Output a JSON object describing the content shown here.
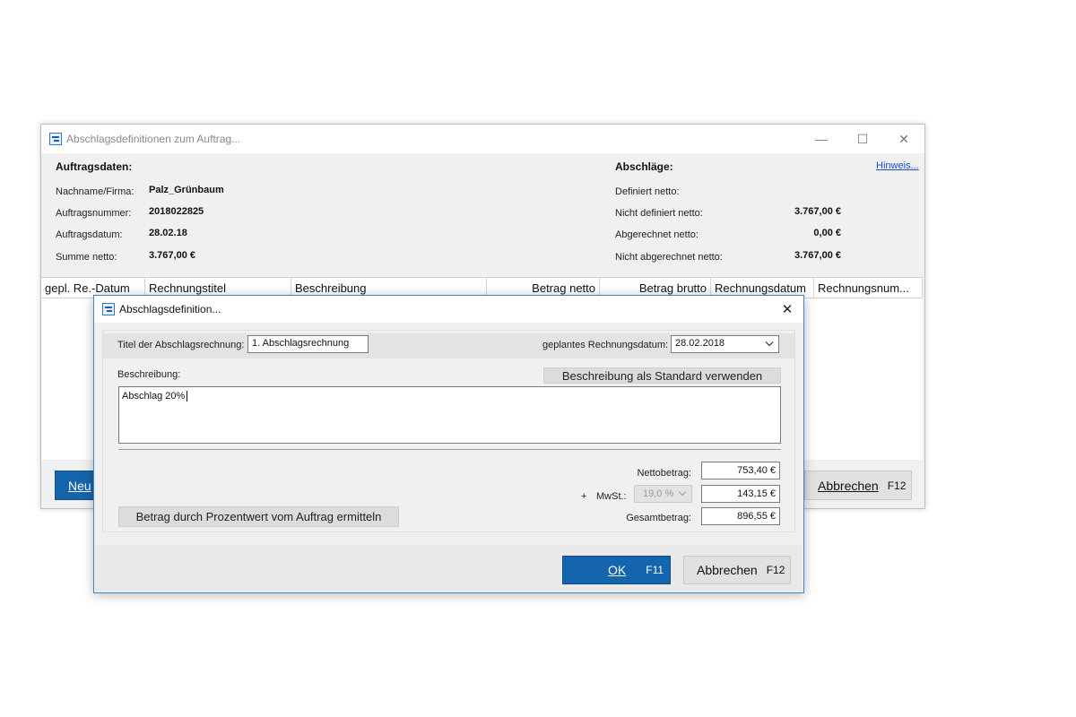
{
  "main_window": {
    "title": "Abschlagsdefinitionen zum Auftrag...",
    "controls": {
      "minimize": "—",
      "maximize": "☐",
      "close": "✕"
    },
    "order": {
      "heading": "Auftragsdaten:",
      "name_label": "Nachname/Firma:",
      "name_value": "Palz_Grünbaum",
      "number_label": "Auftragsnummer:",
      "number_value": "2018022825",
      "date_label": "Auftragsdatum:",
      "date_value": "28.02.18",
      "sum_label": "Summe netto:",
      "sum_value": "3.767,00 €"
    },
    "installments": {
      "heading": "Abschläge:",
      "hint_link": "Hinweis...",
      "defined_label": "Definiert netto:",
      "defined_value": "",
      "undefined_label": "Nicht definiert netto:",
      "undefined_value": "3.767,00 €",
      "billed_label": "Abgerechnet netto:",
      "billed_value": "0,00 €",
      "unbilled_label": "Nicht abgerechnet netto:",
      "unbilled_value": "3.767,00 €"
    },
    "columns": [
      "gepl. Re.-Datum",
      "Rechnungstitel",
      "Beschreibung",
      "Betrag netto",
      "Betrag brutto",
      "Rechnungsdatum",
      "Rechnungsnum..."
    ],
    "new_button": "Neu",
    "cancel_button": {
      "label": "Abbrechen",
      "key": "F12"
    }
  },
  "dialog": {
    "title": "Abschlagsdefinition...",
    "close": "✕",
    "invoice_title_label": "Titel der Abschlagsrechnung:",
    "invoice_title_value": "1. Abschlagsrechnung",
    "planned_date_label": "geplantes Rechnungsdatum:",
    "planned_date_value": "28.02.2018",
    "description_label": "Beschreibung:",
    "use_default_button": "Beschreibung als Standard verwenden",
    "description_value": "Abschlag 20%",
    "net_label": "Nettobetrag:",
    "net_value": "753,40 €",
    "vat_prefix": "+",
    "vat_label": "MwSt.:",
    "vat_rate": "19,0 %",
    "vat_value": "143,15 €",
    "gross_label": "Gesamtbetrag:",
    "gross_value": "896,55 €",
    "percent_button": "Betrag durch Prozentwert vom Auftrag ermitteln",
    "ok_button": {
      "label": "OK",
      "key": "F11"
    },
    "cancel_button": {
      "label": "Abbrechen",
      "key": "F12"
    }
  },
  "colors": {
    "accent": "#1565ad",
    "dialog_border": "#3c86c8",
    "link": "#1a4fd1"
  }
}
